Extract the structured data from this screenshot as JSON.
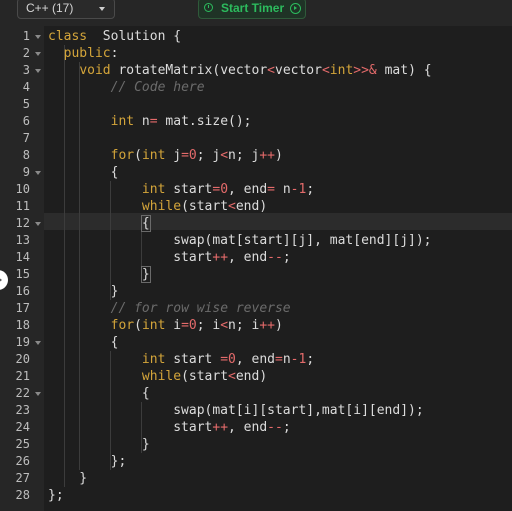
{
  "toolbar": {
    "language": "C++ (17)",
    "timer_label": "Start Timer"
  },
  "editor": {
    "lines": [
      {
        "n": "1",
        "fold": true,
        "t": [
          [
            "kw",
            "class"
          ],
          [
            "",
            "  Solution {"
          ]
        ]
      },
      {
        "n": "2",
        "fold": true,
        "t": [
          [
            "",
            "  "
          ],
          [
            "kw",
            "public"
          ],
          [
            "",
            ":"
          ]
        ]
      },
      {
        "n": "3",
        "fold": true,
        "t": [
          [
            "",
            "    "
          ],
          [
            "kw",
            "void"
          ],
          [
            "",
            " rotateMatrix(vector"
          ],
          [
            "op",
            "<"
          ],
          [
            "",
            "vector"
          ],
          [
            "op",
            "<"
          ],
          [
            "kw",
            "int"
          ],
          [
            "op",
            ">>&"
          ],
          [
            "",
            " mat) {"
          ]
        ]
      },
      {
        "n": "4",
        "fold": false,
        "t": [
          [
            "",
            "        "
          ],
          [
            "cm",
            "// Code here"
          ]
        ]
      },
      {
        "n": "5",
        "fold": false,
        "t": []
      },
      {
        "n": "6",
        "fold": false,
        "t": [
          [
            "",
            "        "
          ],
          [
            "kw",
            "int"
          ],
          [
            "",
            " n"
          ],
          [
            "op",
            "="
          ],
          [
            "",
            " mat.size();"
          ]
        ]
      },
      {
        "n": "7",
        "fold": false,
        "t": []
      },
      {
        "n": "8",
        "fold": false,
        "t": [
          [
            "",
            "        "
          ],
          [
            "kw",
            "for"
          ],
          [
            "",
            "("
          ],
          [
            "kw",
            "int"
          ],
          [
            "",
            " j"
          ],
          [
            "op",
            "="
          ],
          [
            "num",
            "0"
          ],
          [
            "",
            "; j"
          ],
          [
            "op",
            "<"
          ],
          [
            "",
            "n; j"
          ],
          [
            "op",
            "++"
          ],
          [
            "",
            ")"
          ]
        ]
      },
      {
        "n": "9",
        "fold": true,
        "t": [
          [
            "",
            "        {"
          ]
        ]
      },
      {
        "n": "10",
        "fold": false,
        "t": [
          [
            "",
            "            "
          ],
          [
            "kw",
            "int"
          ],
          [
            "",
            " start"
          ],
          [
            "op",
            "="
          ],
          [
            "num",
            "0"
          ],
          [
            "",
            ", end"
          ],
          [
            "op",
            "="
          ],
          [
            "",
            " n"
          ],
          [
            "op",
            "-"
          ],
          [
            "num",
            "1"
          ],
          [
            "",
            ";"
          ]
        ]
      },
      {
        "n": "11",
        "fold": false,
        "t": [
          [
            "",
            "            "
          ],
          [
            "kw",
            "while"
          ],
          [
            "",
            "(start"
          ],
          [
            "op",
            "<"
          ],
          [
            "",
            "end)"
          ]
        ]
      },
      {
        "n": "12",
        "fold": true,
        "t": [
          [
            "",
            "            "
          ],
          [
            "bm",
            "{"
          ]
        ]
      },
      {
        "n": "13",
        "fold": false,
        "t": [
          [
            "",
            "                swap(mat[start][j], mat[end][j]);"
          ]
        ]
      },
      {
        "n": "14",
        "fold": false,
        "t": [
          [
            "",
            "                start"
          ],
          [
            "op",
            "++"
          ],
          [
            "",
            ", end"
          ],
          [
            "op",
            "--"
          ],
          [
            "",
            ";"
          ]
        ]
      },
      {
        "n": "15",
        "fold": false,
        "t": [
          [
            "",
            "            "
          ],
          [
            "bm",
            "}"
          ]
        ]
      },
      {
        "n": "16",
        "fold": false,
        "t": [
          [
            "",
            "        }"
          ]
        ]
      },
      {
        "n": "17",
        "fold": false,
        "t": [
          [
            "",
            "        "
          ],
          [
            "cm",
            "// for row wise reverse"
          ]
        ]
      },
      {
        "n": "18",
        "fold": false,
        "t": [
          [
            "",
            "        "
          ],
          [
            "kw",
            "for"
          ],
          [
            "",
            "("
          ],
          [
            "kw",
            "int"
          ],
          [
            "",
            " i"
          ],
          [
            "op",
            "="
          ],
          [
            "num",
            "0"
          ],
          [
            "",
            "; i"
          ],
          [
            "op",
            "<"
          ],
          [
            "",
            "n; i"
          ],
          [
            "op",
            "++"
          ],
          [
            "",
            ")"
          ]
        ]
      },
      {
        "n": "19",
        "fold": true,
        "t": [
          [
            "",
            "        {"
          ]
        ]
      },
      {
        "n": "20",
        "fold": false,
        "t": [
          [
            "",
            "            "
          ],
          [
            "kw",
            "int"
          ],
          [
            "",
            " start "
          ],
          [
            "op",
            "="
          ],
          [
            "num",
            "0"
          ],
          [
            "",
            ", end"
          ],
          [
            "op",
            "="
          ],
          [
            "",
            "n"
          ],
          [
            "op",
            "-"
          ],
          [
            "num",
            "1"
          ],
          [
            "",
            ";"
          ]
        ]
      },
      {
        "n": "21",
        "fold": false,
        "t": [
          [
            "",
            "            "
          ],
          [
            "kw",
            "while"
          ],
          [
            "",
            "(start"
          ],
          [
            "op",
            "<"
          ],
          [
            "",
            "end)"
          ]
        ]
      },
      {
        "n": "22",
        "fold": true,
        "t": [
          [
            "",
            "            {"
          ]
        ]
      },
      {
        "n": "23",
        "fold": false,
        "t": [
          [
            "",
            "                swap(mat[i][start],mat[i][end]);"
          ]
        ]
      },
      {
        "n": "24",
        "fold": false,
        "t": [
          [
            "",
            "                start"
          ],
          [
            "op",
            "++"
          ],
          [
            "",
            ", end"
          ],
          [
            "op",
            "--"
          ],
          [
            "",
            ";"
          ]
        ]
      },
      {
        "n": "25",
        "fold": false,
        "t": [
          [
            "",
            "            }"
          ]
        ]
      },
      {
        "n": "26",
        "fold": false,
        "t": [
          [
            "",
            "        };"
          ]
        ]
      },
      {
        "n": "27",
        "fold": false,
        "t": [
          [
            "",
            "    }"
          ]
        ]
      },
      {
        "n": "28",
        "fold": false,
        "t": [
          [
            "",
            "};"
          ]
        ]
      }
    ]
  }
}
